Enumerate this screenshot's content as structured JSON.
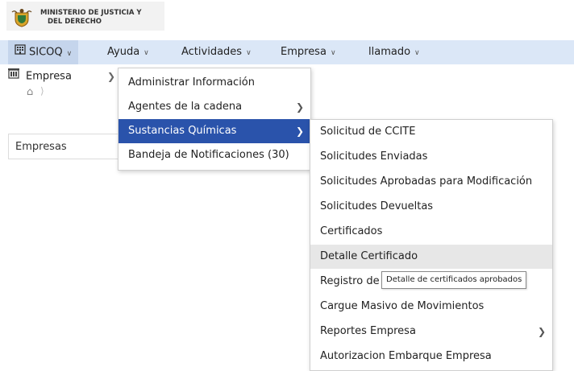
{
  "header": {
    "logo_line1": "MINISTERIO DE JUSTICIA Y",
    "logo_line2": "DEL DERECHO",
    "logo_icon": "coat-of-arms"
  },
  "nav": {
    "items": [
      {
        "label": "SICOQ",
        "icon": "building-icon",
        "has_dropdown": true
      },
      {
        "label": "Ayuda",
        "has_dropdown": true
      },
      {
        "label": "Actividades",
        "has_dropdown": true
      },
      {
        "label": "Empresa",
        "has_dropdown": true
      },
      {
        "label": "llamado",
        "has_dropdown": true
      }
    ]
  },
  "subnav": {
    "label": "Empresa",
    "icon": "building-icon"
  },
  "breadcrumb": {
    "icon": "home-icon"
  },
  "field": {
    "value": "Empresas"
  },
  "menu_empresa": {
    "items": [
      {
        "label": "Administrar Información",
        "has_submenu": false
      },
      {
        "label": "Agentes de la cadena",
        "has_submenu": true
      },
      {
        "label": "Sustancias Químicas",
        "has_submenu": true,
        "active": true
      },
      {
        "label": "Bandeja de Notificaciones (30)",
        "has_submenu": false
      }
    ]
  },
  "menu_sustancias": {
    "items": [
      {
        "label": "Solicitud de CCITE"
      },
      {
        "label": "Solicitudes Enviadas"
      },
      {
        "label": "Solicitudes Aprobadas para Modificación"
      },
      {
        "label": "Solicitudes Devueltas"
      },
      {
        "label": "Certificados"
      },
      {
        "label": "Detalle Certificado",
        "hover": true
      },
      {
        "label": "Registro de Movimientos"
      },
      {
        "label": "Cargue Masivo de Movimientos"
      },
      {
        "label": "Reportes Empresa",
        "has_submenu": true
      },
      {
        "label": "Autorizacion Embarque Empresa"
      }
    ]
  },
  "tooltip": {
    "text": "Detalle de certificados aprobados"
  },
  "colors": {
    "nav_bg": "#dbe7f7",
    "active_item": "#2a53ab",
    "hover_item": "#e7e7e7"
  }
}
